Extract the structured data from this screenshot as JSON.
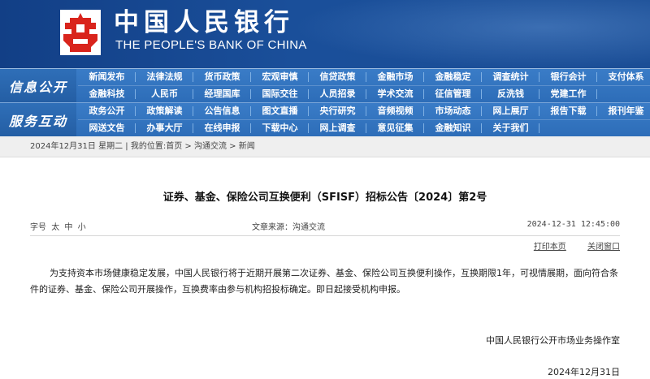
{
  "header": {
    "name_cn": "中国人民银行",
    "name_en": "THE PEOPLE'S BANK OF CHINA"
  },
  "nav": {
    "info": {
      "title": "信息公开",
      "rows": [
        [
          "新闻发布",
          "法律法规",
          "货币政策",
          "宏观审慎",
          "信贷政策",
          "金融市场",
          "金融稳定",
          "调查统计",
          "银行会计",
          "支付体系"
        ],
        [
          "金融科技",
          "人民币",
          "经理国库",
          "国际交往",
          "人员招录",
          "学术交流",
          "征信管理",
          "反洗钱",
          "党建工作"
        ]
      ]
    },
    "service": {
      "title": "服务互动",
      "rows": [
        [
          "政务公开",
          "政策解读",
          "公告信息",
          "图文直播",
          "央行研究",
          "音频视频",
          "市场动态",
          "网上展厅",
          "报告下载",
          "报刊年鉴"
        ],
        [
          "网送文告",
          "办事大厅",
          "在线申报",
          "下载中心",
          "网上调查",
          "意见征集",
          "金融知识",
          "关于我们"
        ]
      ]
    }
  },
  "breadcrumb": {
    "date": "2024年12月31日 星期二",
    "separator": "|",
    "location_label": "我的位置:",
    "home": "首页",
    "arrow": ">",
    "section": "沟通交流",
    "current": "新闻"
  },
  "article": {
    "title": "证券、基金、保险公司互换便利（SFISF）招标公告〔2024〕第2号",
    "font_size_label": "字号",
    "font_sizes": [
      "太",
      "中",
      "小"
    ],
    "source": "文章来源：沟通交流",
    "published": "2024-12-31  12:45:00",
    "print_label": "打印本页",
    "close_label": "关闭窗口",
    "body": "为支持资本市场健康稳定发展，中国人民银行将于近期开展第二次证券、基金、保险公司互换便利操作，互换期限1年，可视情展期，面向符合条件的证券、基金、保险公司开展操作，互换费率由参与机构招投标确定。即日起接受机构申报。",
    "signature": "中国人民银行公开市场业务操作室",
    "sign_date": "2024年12月31日"
  },
  "colors": {
    "header_blue": "#1a4f9a",
    "nav_blue": "#3a7cc7",
    "logo_red": "#d9241c"
  }
}
